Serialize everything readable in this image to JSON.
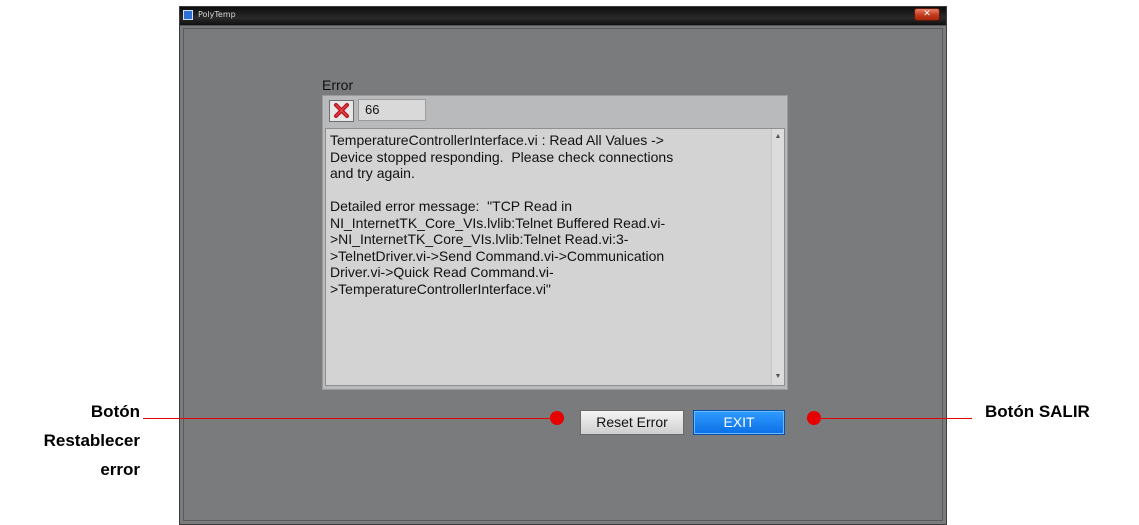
{
  "window": {
    "title": "PolyTemp",
    "close_glyph": "✕"
  },
  "error_panel": {
    "label": "Error",
    "status_icon": "error-x-icon",
    "code": "66",
    "message": "TemperatureControllerInterface.vi : Read All Values ->\nDevice stopped responding.  Please check connections\nand try again.\n\nDetailed error message:  \"TCP Read in\nNI_InternetTK_Core_VIs.lvlib:Telnet Buffered Read.vi-\n>NI_InternetTK_Core_VIs.lvlib:Telnet Read.vi:3-\n>TelnetDriver.vi->Send Command.vi->Communication\nDriver.vi->Quick Read Command.vi-\n>TemperatureControllerInterface.vi\""
  },
  "buttons": {
    "reset_label": "Reset Error",
    "exit_label": "EXIT"
  },
  "callouts": {
    "left": [
      "Botón",
      "Restablecer",
      "error"
    ],
    "right": "Botón SALIR"
  },
  "colors": {
    "callout_line": "#e60000",
    "exit_button": "#0b6ee6"
  }
}
